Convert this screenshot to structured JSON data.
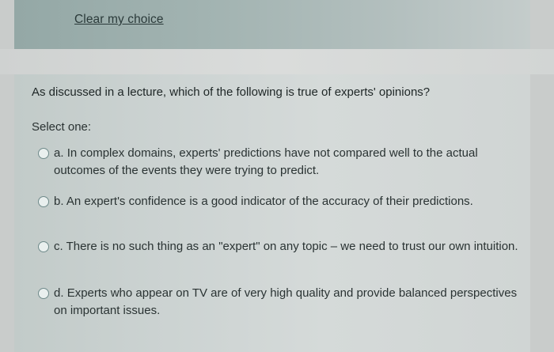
{
  "clear_choice": "Clear my choice",
  "question": "As discussed in a lecture, which of the following is true of experts' opinions?",
  "select_label": "Select one:",
  "options": [
    {
      "letter": "a.",
      "text": "In complex domains, experts' predictions have not compared well to the actual outcomes of the events they were trying to predict."
    },
    {
      "letter": "b.",
      "text": "An expert's confidence is a good indicator of the accuracy of their predictions."
    },
    {
      "letter": "c.",
      "text": "There is no such thing as an \"expert\" on any topic – we need to trust our own intuition."
    },
    {
      "letter": "d.",
      "text": "Experts who appear on TV are of very high quality and provide balanced perspectives on important issues."
    }
  ]
}
